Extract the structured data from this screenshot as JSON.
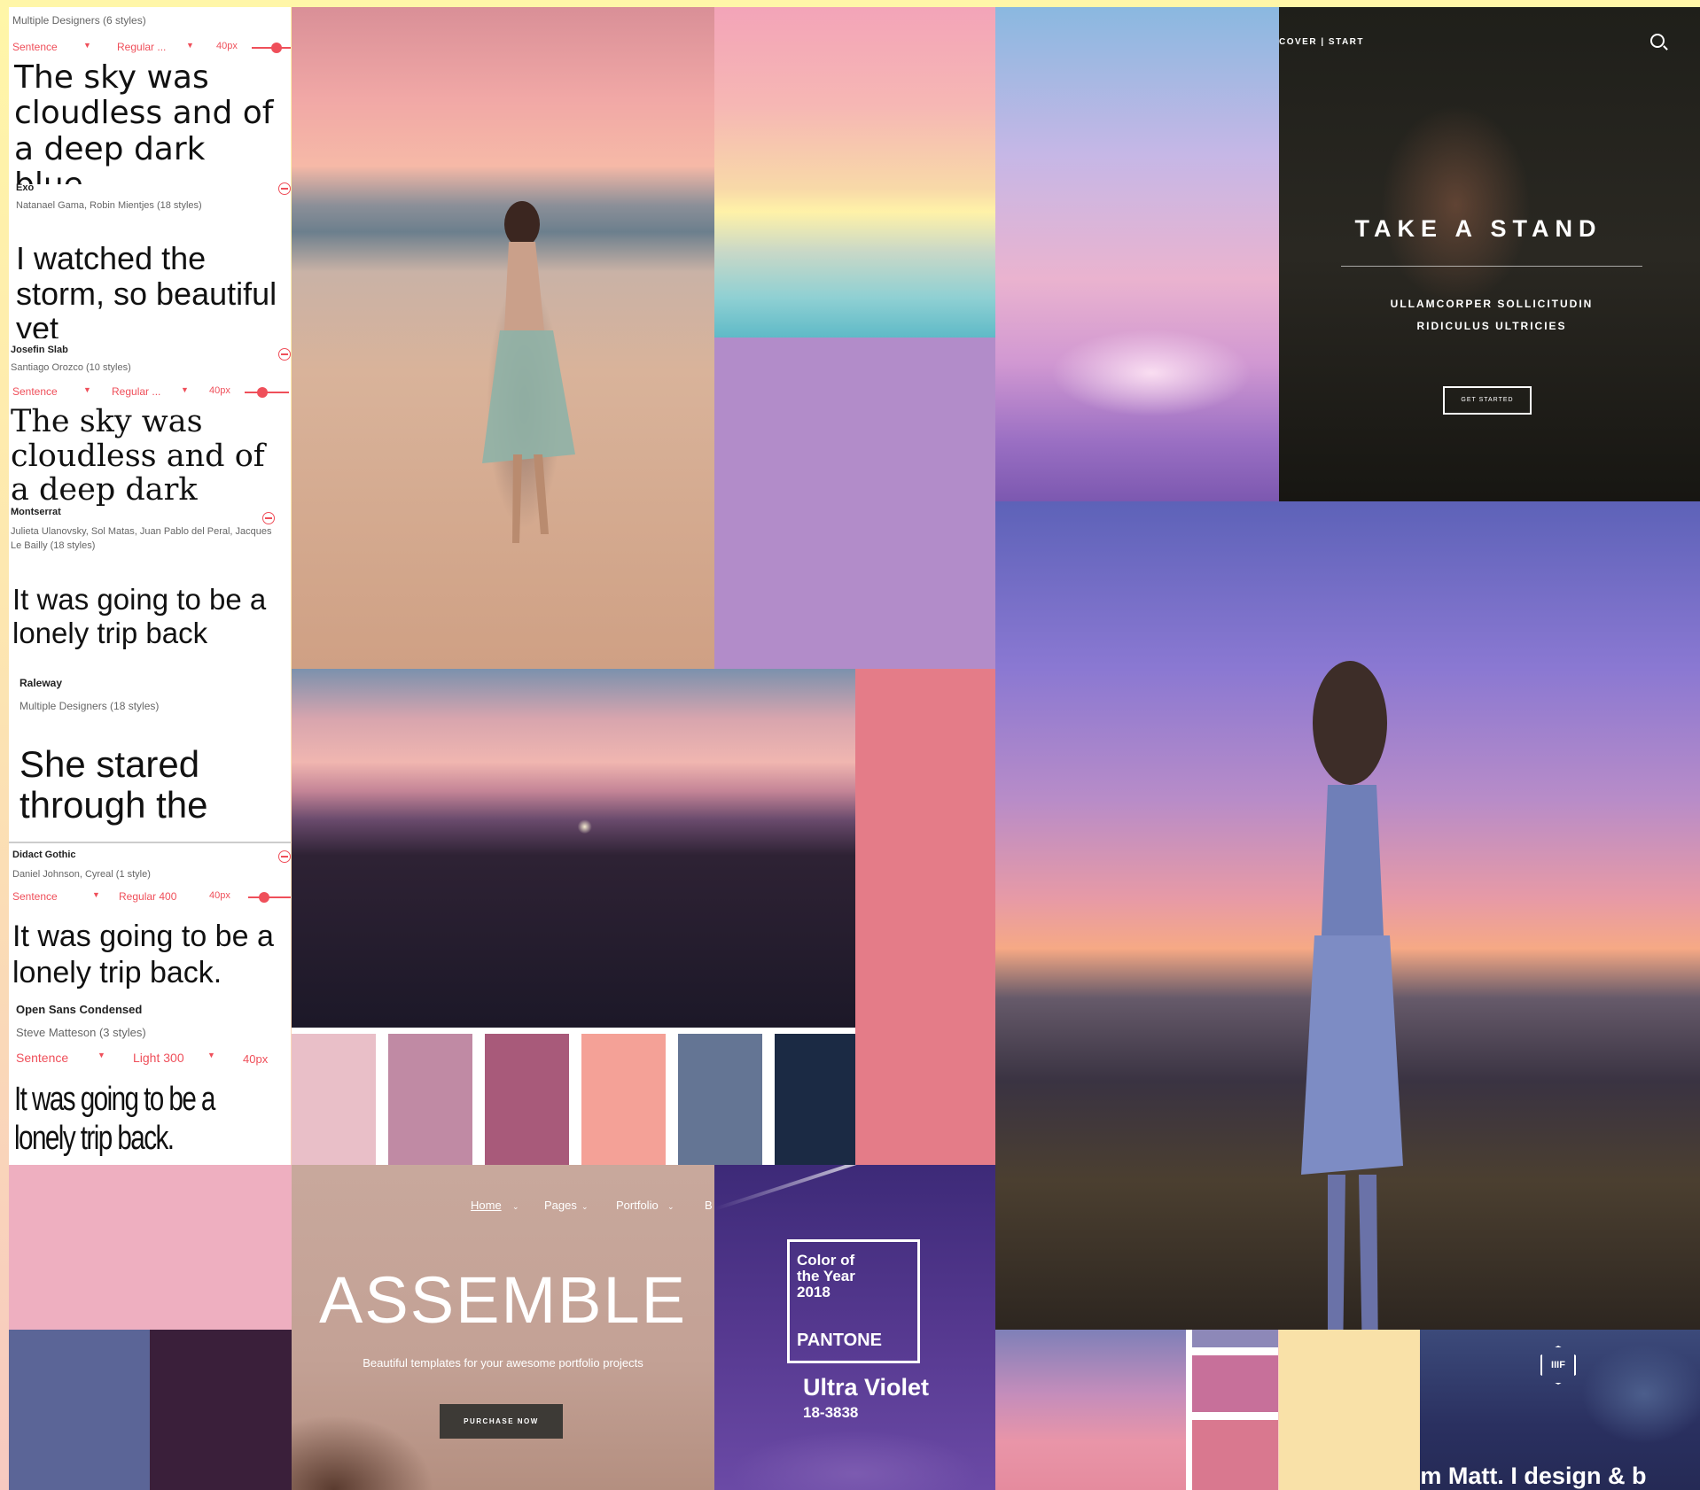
{
  "specimens": [
    {
      "name": "",
      "designers": "Multiple Designers (6 styles)",
      "controls": {
        "case": "Sentence",
        "weight": "Regular ...",
        "size": "40px"
      },
      "sample": "The sky was cloudless and of a deep dark blue."
    },
    {
      "name": "Exo",
      "designers": "Natanael Gama, Robin Mientjes (18 styles)",
      "sample": "I watched the storm, so beautiful yet"
    },
    {
      "name": "Josefin Slab",
      "designers": "Santiago Orozco (10 styles)",
      "controls": {
        "case": "Sentence",
        "weight": "Regular ...",
        "size": "40px"
      },
      "sample": "The sky was cloudless and of a deep dark blue."
    },
    {
      "name": "Montserrat",
      "designers": "Julieta Ulanovsky, Sol Matas, Juan Pablo del Peral, Jacques Le Bailly (18 styles)",
      "sample": "It was going to be a lonely trip back"
    },
    {
      "name": "Raleway",
      "designers": "Multiple Designers (18 styles)",
      "sample": "She stared through the"
    },
    {
      "name": "Didact Gothic",
      "designers": "Daniel Johnson, Cyreal (1 style)",
      "controls": {
        "case": "Sentence",
        "weight": "Regular 400",
        "size": "40px"
      },
      "sample": "It was going to be a lonely trip back."
    },
    {
      "name": "Open Sans Condensed",
      "designers": "Steve Matteson (3 styles)",
      "controls": {
        "case": "Sentence",
        "weight": "Light 300",
        "size": "40px"
      },
      "sample": "It was going to be a lonely trip back."
    }
  ],
  "hero_stand": {
    "nav": "COVER | START",
    "title": "TAKE A STAND",
    "subtitle_line1": "ULLAMCORPER SOLLICITUDIN",
    "subtitle_line2": "RIDICULUS ULTRICIES",
    "cta": "GET STARTED"
  },
  "hero_assemble": {
    "nav": [
      "Home",
      "Pages",
      "Portfolio",
      "B"
    ],
    "title": "ASSEMBLE",
    "tagline": "Beautiful templates for your awesome portfolio projects",
    "button": "PURCHASE NOW"
  },
  "pantone": {
    "coty_line1": "Color of",
    "coty_line2": "the Year",
    "coty_line3": "2018",
    "brand": "PANTONE",
    "name": "Ultra Violet",
    "code": "18-3838"
  },
  "hero_matt": {
    "logo": "IIIF",
    "headline": "'m Matt. I design & b"
  },
  "colors": {
    "lavender": "#b28cc9",
    "coral": "#e47c88",
    "blush": "#eeafc0",
    "slate_blue": "#5b6597",
    "eggplant": "#3a1f3a",
    "cream": "#f9e1a8",
    "accent_red": "#ef4f5a",
    "palette": [
      "#e9bfc8",
      "#c08aa4",
      "#a85a7a",
      "#f4a197",
      "#647594",
      "#1b2a44"
    ],
    "mini_palette": [
      "#8d88b8",
      "#c7709a",
      "#d9788f"
    ]
  }
}
